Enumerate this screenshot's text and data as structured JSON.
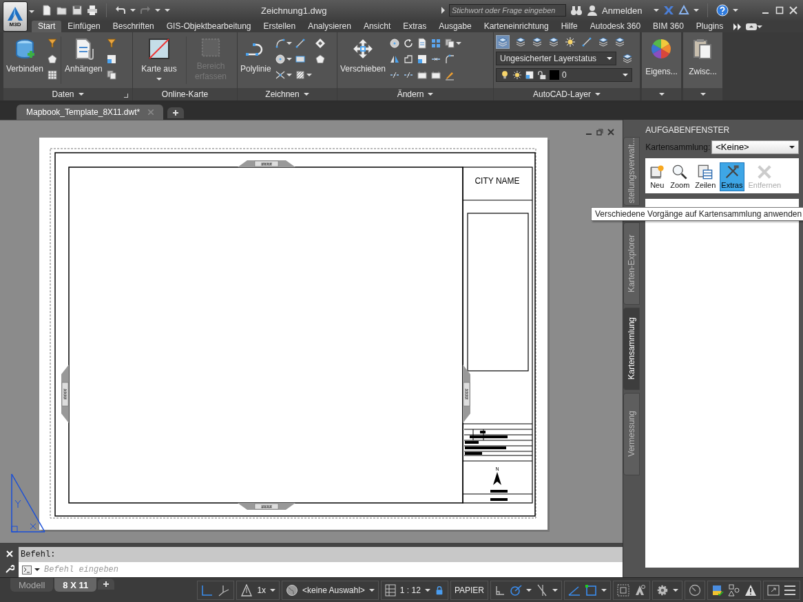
{
  "app_menu": {
    "label": "M3D"
  },
  "window": {
    "title": "Zeichnung1.dwg"
  },
  "search": {
    "placeholder": "Stichwort oder Frage eingeben"
  },
  "account": {
    "label": "Anmelden"
  },
  "ribbon": {
    "tabs": [
      {
        "label": "Start",
        "selected": true
      },
      {
        "label": "Einfügen",
        "selected": false
      },
      {
        "label": "Beschriften",
        "selected": false
      },
      {
        "label": "GIS-Objektbearbeitung",
        "selected": false
      },
      {
        "label": "Erstellen",
        "selected": false
      },
      {
        "label": "Analysieren",
        "selected": false
      },
      {
        "label": "Ansicht",
        "selected": false
      },
      {
        "label": "Extras",
        "selected": false
      },
      {
        "label": "Ausgabe",
        "selected": false
      },
      {
        "label": "Karteneinrichtung",
        "selected": false
      },
      {
        "label": "Hilfe",
        "selected": false
      },
      {
        "label": "Autodesk 360",
        "selected": false
      },
      {
        "label": "BIM 360",
        "selected": false
      },
      {
        "label": "Plugins",
        "selected": false
      }
    ],
    "panels": [
      {
        "title": "Daten",
        "expandable": true,
        "buttons": [
          {
            "label": "Verbinden",
            "disabled": false
          },
          {
            "label": "Anhängen",
            "disabled": false
          }
        ]
      },
      {
        "title": "Online-Karte",
        "expandable": false,
        "buttons": [
          {
            "label": "Karte aus",
            "disabled": false
          },
          {
            "label": "Bereich erfassen",
            "disabled": true
          }
        ]
      },
      {
        "title": "Zeichnen",
        "expandable": true,
        "buttons": [
          {
            "label": "Polylinie",
            "disabled": false
          }
        ]
      },
      {
        "title": "Ändern",
        "expandable": true,
        "buttons": [
          {
            "label": "Verschieben",
            "disabled": false
          }
        ]
      },
      {
        "title": "AutoCAD-Layer",
        "expandable": true,
        "layer_state": "Ungesicherter Layerstatus",
        "current_layer": "0"
      },
      {
        "expandable": true,
        "buttons": [
          {
            "label": "Eigens...",
            "disabled": false
          }
        ]
      },
      {
        "expandable": true,
        "buttons": [
          {
            "label": "Zwisc...",
            "disabled": false
          }
        ]
      }
    ]
  },
  "document_tabs": [
    {
      "label": "Mapbook_Template_8X11.dwt*",
      "selected": true
    }
  ],
  "drawing": {
    "city_name": "CITY NAME",
    "grid_labels": [
      "####",
      "####",
      "####",
      "####"
    ],
    "north_label": "N"
  },
  "task_pane": {
    "title": "AUFGABENFENSTER",
    "side_tabs": [
      {
        "label": "stellungsverwalt...",
        "selected": false
      },
      {
        "label": "Karten-Explorer",
        "selected": false
      },
      {
        "label": "Kartensammlung",
        "selected": true
      },
      {
        "label": "Vermessung",
        "selected": false
      }
    ],
    "collection_label": "Kartensammlung:",
    "collection_value": "<Keine>",
    "tools": [
      {
        "label": "Neu",
        "selected": false,
        "disabled": false
      },
      {
        "label": "Zoom",
        "selected": false,
        "disabled": false
      },
      {
        "label": "Zeilen",
        "selected": false,
        "disabled": false
      },
      {
        "label": "Extras",
        "selected": true,
        "disabled": false
      },
      {
        "label": "Entfernen",
        "selected": false,
        "disabled": true
      }
    ],
    "tooltip": "Verschiedene Vorgänge auf Kartensammlung anwenden"
  },
  "command_line": {
    "history": "Befehl:",
    "placeholder": "Befehl eingeben"
  },
  "layout_tabs": [
    {
      "label": "Modell",
      "selected": false
    },
    {
      "label": "8 X 11",
      "selected": true
    }
  ],
  "status_bar": {
    "annotation_scale": "1x",
    "coordinate_system": "<keine Auswahl>",
    "viewport_scale": "1 : 12",
    "space": "PAPIER",
    "toggles": [
      {
        "on": true
      },
      {
        "on": false
      },
      {
        "on": false
      },
      {
        "on": true
      },
      {
        "on": false
      },
      {
        "on": true
      },
      {
        "on": true
      }
    ]
  }
}
